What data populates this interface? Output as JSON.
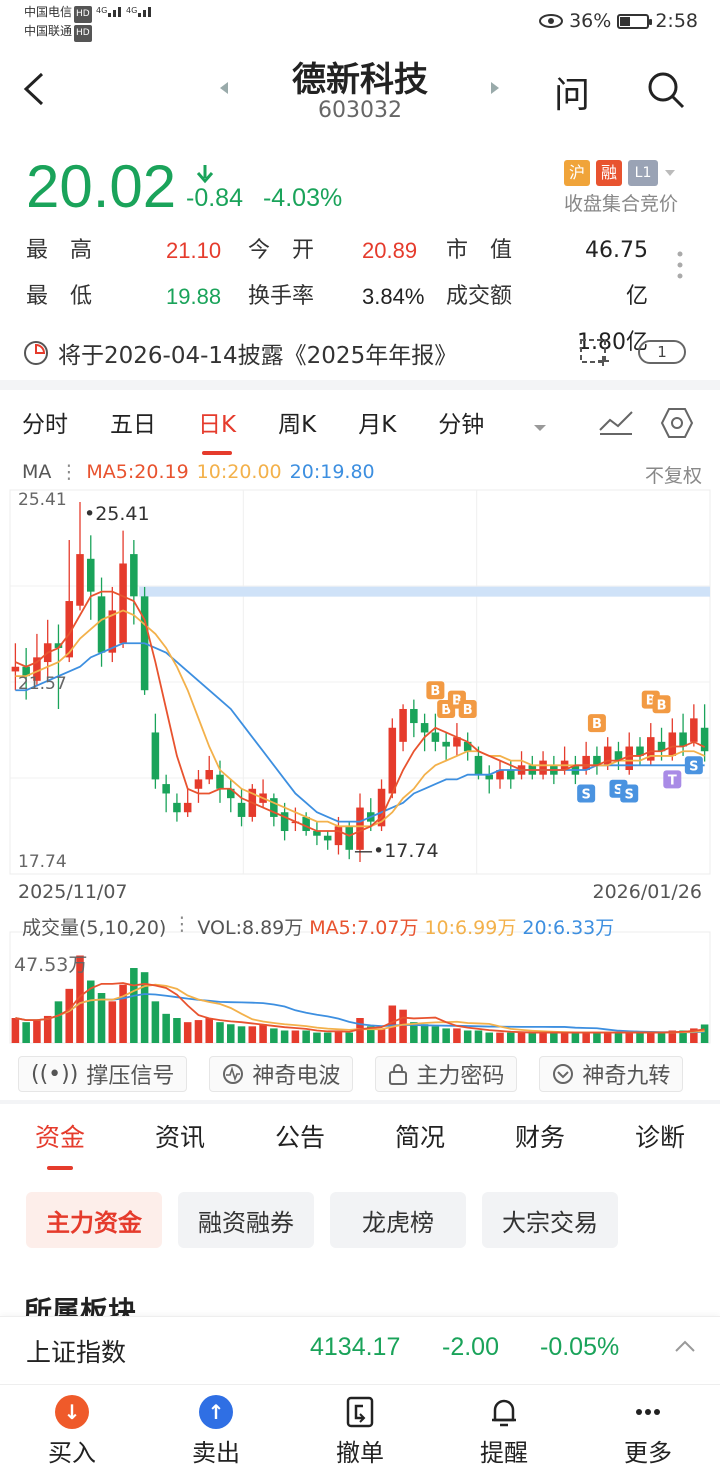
{
  "status": {
    "carrier1": "中国电信",
    "carrier2": "中国联通",
    "hd": "HD",
    "net": "4G",
    "battery_pct": "36%",
    "battery_level": 0.36,
    "time": "2:58"
  },
  "header": {
    "title": "德新科技",
    "code": "603032",
    "qa_icon": "问"
  },
  "quote": {
    "price": "20.02",
    "change": "-0.84",
    "change_pct": "-4.03%",
    "badge_sh": "沪",
    "badge_rong": "融",
    "badge_l1": "L1",
    "auction_note": "收盘集合竞价",
    "high_label": "最　高",
    "high": "21.10",
    "open_label": "今　开",
    "open": "20.89",
    "mcap_label": "市　值",
    "mcap": "46.75亿",
    "low_label": "最　低",
    "low": "19.88",
    "turnover_label": "换手率",
    "turnover": "3.84%",
    "amount_label": "成交额",
    "amount": "1.80亿"
  },
  "notice": {
    "text": "将于2026-04-14披露《2025年年报》",
    "count": "1"
  },
  "chart_tabs": [
    "分时",
    "五日",
    "日K",
    "周K",
    "月K",
    "分钟"
  ],
  "ma_row": {
    "label": "MA",
    "ma5": "MA5:20.19",
    "ma10": "10:20.00",
    "ma20": "20:19.80",
    "adjust": "不复权"
  },
  "price_axis": {
    "top": "25.41",
    "mid": "21.57",
    "bottom": "17.74",
    "max_marker": "25.41",
    "min_marker": "17.74",
    "date_start": "2025/11/07",
    "date_end": "2026/01/26"
  },
  "vol_row": {
    "label": "成交量(5,10,20)",
    "vol": "VOL:8.89万",
    "ma5": "MA5:7.07万",
    "ma10": "10:6.99万",
    "ma20": "20:6.33万",
    "axis_top": "47.53万"
  },
  "signal_buttons": [
    "撑压信号",
    "神奇电波",
    "主力密码",
    "神奇九转"
  ],
  "feature_tabs": [
    "资金",
    "资讯",
    "公告",
    "简况",
    "财务",
    "诊断"
  ],
  "chips": [
    "主力资金",
    "融资融券",
    "龙虎榜",
    "大宗交易"
  ],
  "section_title": "所属板块",
  "index_bar": {
    "name": "上证指数",
    "value": "4134.17",
    "change": "-2.00",
    "pct": "-0.05%"
  },
  "bottom_nav": [
    "买入",
    "卖出",
    "撤单",
    "提醒",
    "更多"
  ],
  "colors": {
    "up": "#e53b2c",
    "down": "#1aa35a",
    "ma5": "#e8532f",
    "ma10": "#f3b14b",
    "ma20": "#3d8fe0"
  },
  "chart_data": {
    "type": "candlestick",
    "ylim": [
      17.74,
      25.41
    ],
    "candles": [
      [
        21.8,
        21.9,
        22.4,
        21.4
      ],
      [
        21.9,
        21.7,
        22.3,
        21.2
      ],
      [
        21.6,
        22.1,
        22.6,
        21.5
      ],
      [
        22.0,
        22.4,
        22.9,
        21.6
      ],
      [
        22.4,
        22.3,
        22.8,
        21.0
      ],
      [
        22.1,
        23.3,
        24.6,
        22.0
      ],
      [
        23.2,
        24.3,
        25.41,
        23.1
      ],
      [
        24.2,
        23.5,
        24.7,
        22.9
      ],
      [
        23.4,
        22.2,
        23.8,
        21.9
      ],
      [
        22.2,
        23.1,
        23.6,
        22.0
      ],
      [
        22.4,
        24.1,
        24.8,
        22.3
      ],
      [
        24.3,
        23.4,
        24.6,
        22.8
      ],
      [
        23.4,
        21.4,
        23.6,
        21.3
      ],
      [
        20.5,
        19.5,
        20.9,
        19.3
      ],
      [
        19.4,
        19.2,
        19.6,
        18.8
      ],
      [
        19.0,
        18.8,
        19.2,
        18.6
      ],
      [
        18.8,
        19.0,
        19.3,
        18.7
      ],
      [
        19.3,
        19.5,
        19.7,
        19.0
      ],
      [
        19.5,
        19.7,
        20.0,
        19.4
      ],
      [
        19.6,
        19.3,
        19.9,
        19.0
      ],
      [
        19.3,
        19.1,
        19.5,
        18.8
      ],
      [
        19.0,
        18.7,
        19.3,
        18.5
      ],
      [
        18.7,
        19.3,
        19.4,
        18.6
      ],
      [
        19.0,
        19.2,
        19.5,
        18.9
      ],
      [
        19.1,
        18.7,
        19.2,
        18.5
      ],
      [
        18.8,
        18.4,
        19.0,
        18.2
      ],
      [
        18.6,
        18.6,
        18.9,
        18.4
      ],
      [
        18.7,
        18.4,
        18.8,
        18.3
      ],
      [
        18.4,
        18.3,
        18.6,
        18.1
      ],
      [
        18.3,
        18.2,
        18.4,
        18.0
      ],
      [
        18.1,
        18.5,
        18.7,
        17.9
      ],
      [
        18.5,
        18.0,
        18.6,
        17.8
      ],
      [
        18.0,
        18.9,
        19.2,
        17.74
      ],
      [
        18.8,
        18.6,
        19.1,
        18.4
      ],
      [
        18.5,
        19.3,
        19.5,
        18.4
      ],
      [
        19.2,
        20.6,
        20.8,
        19.1
      ],
      [
        20.3,
        21.0,
        21.1,
        20.1
      ],
      [
        21.0,
        20.7,
        21.2,
        20.4
      ],
      [
        20.7,
        20.5,
        20.9,
        20.1
      ],
      [
        20.5,
        20.3,
        20.9,
        20.1
      ],
      [
        20.3,
        20.2,
        20.5,
        19.9
      ],
      [
        20.2,
        20.4,
        20.7,
        20.0
      ],
      [
        20.3,
        20.1,
        20.5,
        19.9
      ],
      [
        20.0,
        19.6,
        20.2,
        19.5
      ],
      [
        19.6,
        19.5,
        19.8,
        19.2
      ],
      [
        19.5,
        19.7,
        19.9,
        19.3
      ],
      [
        19.7,
        19.5,
        19.9,
        19.3
      ],
      [
        19.6,
        19.8,
        20.1,
        19.5
      ],
      [
        19.8,
        19.6,
        20.0,
        19.5
      ],
      [
        19.6,
        19.9,
        20.1,
        19.5
      ],
      [
        19.8,
        19.6,
        20.0,
        19.4
      ],
      [
        19.7,
        19.9,
        20.2,
        19.6
      ],
      [
        19.8,
        19.6,
        20.0,
        19.4
      ],
      [
        19.7,
        20.0,
        20.3,
        19.6
      ],
      [
        20.0,
        19.8,
        20.2,
        19.6
      ],
      [
        19.8,
        20.2,
        20.4,
        19.7
      ],
      [
        20.1,
        19.9,
        20.3,
        19.7
      ],
      [
        19.7,
        20.2,
        20.5,
        19.6
      ],
      [
        20.2,
        20.0,
        20.4,
        19.8
      ],
      [
        19.9,
        20.4,
        20.7,
        19.8
      ],
      [
        20.3,
        20.1,
        20.6,
        19.9
      ],
      [
        20.0,
        20.5,
        20.8,
        19.9
      ],
      [
        20.5,
        20.2,
        20.9,
        20.0
      ],
      [
        20.3,
        20.8,
        21.1,
        20.2
      ],
      [
        20.6,
        20.1,
        21.1,
        19.88
      ]
    ],
    "ma5": [
      22.0,
      21.9,
      22.0,
      22.2,
      22.3,
      22.6,
      23.0,
      23.4,
      23.5,
      23.5,
      23.4,
      23.3,
      22.9,
      22.0,
      21.0,
      20.0,
      19.3,
      19.2,
      19.2,
      19.3,
      19.3,
      19.1,
      19.0,
      18.9,
      18.8,
      18.7,
      18.6,
      18.5,
      18.4,
      18.4,
      18.4,
      18.3,
      18.4,
      18.5,
      18.7,
      19.2,
      19.7,
      20.1,
      20.4,
      20.6,
      20.5,
      20.4,
      20.3,
      20.1,
      20.0,
      19.9,
      19.8,
      19.7,
      19.7,
      19.7,
      19.7,
      19.7,
      19.8,
      19.8,
      19.8,
      19.9,
      19.9,
      20.0,
      20.0,
      20.1,
      20.1,
      20.2,
      20.2,
      20.3,
      20.19
    ],
    "ma10": [
      21.7,
      21.7,
      21.8,
      21.9,
      22.0,
      22.2,
      22.5,
      22.7,
      22.9,
      23.0,
      23.1,
      23.0,
      22.8,
      22.6,
      22.3,
      21.9,
      21.4,
      20.8,
      20.2,
      19.7,
      19.5,
      19.3,
      19.2,
      19.1,
      19.0,
      18.9,
      18.8,
      18.7,
      18.6,
      18.6,
      18.5,
      18.5,
      18.5,
      18.5,
      18.6,
      18.8,
      19.1,
      19.3,
      19.6,
      19.8,
      19.9,
      20.0,
      20.1,
      20.1,
      20.0,
      20.0,
      19.9,
      19.9,
      19.8,
      19.8,
      19.8,
      19.8,
      19.8,
      19.8,
      19.8,
      19.8,
      19.9,
      19.9,
      19.9,
      20.0,
      20.0,
      20.0,
      20.1,
      20.1,
      20.0
    ],
    "ma20": [
      21.4,
      21.4,
      21.5,
      21.6,
      21.7,
      21.8,
      21.9,
      22.1,
      22.2,
      22.3,
      22.4,
      22.4,
      22.4,
      22.3,
      22.2,
      22.0,
      21.8,
      21.6,
      21.4,
      21.2,
      21.0,
      20.7,
      20.4,
      20.1,
      19.8,
      19.5,
      19.2,
      19.0,
      18.8,
      18.7,
      18.6,
      18.6,
      18.6,
      18.7,
      18.8,
      18.9,
      19.0,
      19.2,
      19.3,
      19.4,
      19.5,
      19.5,
      19.6,
      19.6,
      19.6,
      19.7,
      19.7,
      19.7,
      19.7,
      19.7,
      19.7,
      19.7,
      19.7,
      19.7,
      19.8,
      19.8,
      19.8,
      19.8,
      19.8,
      19.8,
      19.8,
      19.8,
      19.8,
      19.8,
      19.8
    ],
    "volume": [
      12,
      10,
      11,
      13,
      20,
      26,
      42,
      30,
      24,
      20,
      28,
      36,
      34,
      20,
      14,
      12,
      10,
      11,
      12,
      10,
      9,
      8,
      8,
      9,
      7,
      6,
      6,
      6,
      5,
      5,
      6,
      5,
      12,
      8,
      7,
      18,
      16,
      10,
      9,
      8,
      7,
      7,
      6,
      6,
      5,
      5,
      5,
      5,
      5,
      5,
      5,
      5,
      5,
      5,
      5,
      5,
      5,
      5,
      5,
      5,
      5,
      6,
      6,
      7,
      8.89
    ],
    "vol_max": 47.53,
    "support_band": 23.5,
    "markers": [
      {
        "i": 39,
        "label": "B"
      },
      {
        "i": 40,
        "label": "B"
      },
      {
        "i": 41,
        "label": "B"
      },
      {
        "i": 42,
        "label": "B"
      },
      {
        "i": 53,
        "label": "S"
      },
      {
        "i": 54,
        "label": "B"
      },
      {
        "i": 56,
        "label": "S"
      },
      {
        "i": 57,
        "label": "S"
      },
      {
        "i": 59,
        "label": "B"
      },
      {
        "i": 60,
        "label": "B"
      },
      {
        "i": 61,
        "label": "T"
      },
      {
        "i": 63,
        "label": "S"
      }
    ]
  }
}
